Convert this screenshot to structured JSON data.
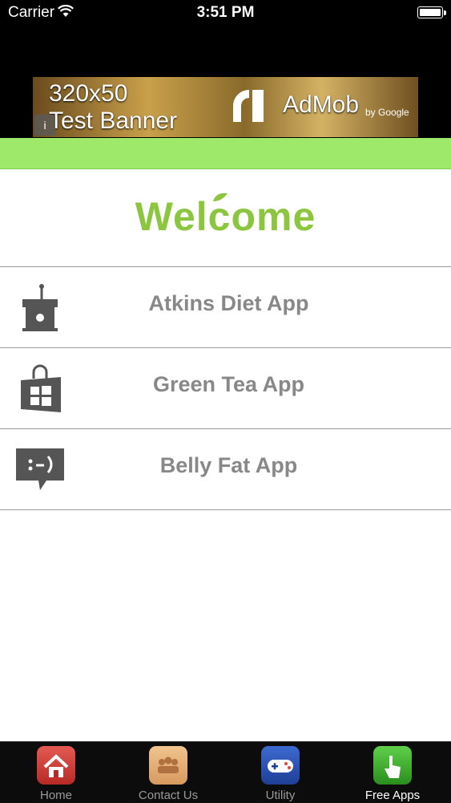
{
  "status_bar": {
    "carrier": "Carrier",
    "time": "3:51 PM"
  },
  "ad": {
    "size_text": "320x50",
    "test_text": "Test Banner",
    "info_glyph": "i",
    "brand": "AdMob",
    "byline": "by Google"
  },
  "welcome": {
    "title": "Welcome"
  },
  "menu": {
    "items": [
      {
        "label": "Atkins Diet App",
        "icon": "podium-microphone-icon"
      },
      {
        "label": "Green Tea App",
        "icon": "windows-store-bag-icon"
      },
      {
        "label": "Belly Fat App",
        "icon": "chat-bubble-emoticon-icon"
      }
    ]
  },
  "tabs": [
    {
      "label": "Home",
      "icon": "house-icon",
      "color": "#d23a34"
    },
    {
      "label": "Contact Us",
      "icon": "contacts-group-icon",
      "color": "#e2ad74"
    },
    {
      "label": "Utility",
      "icon": "gamepad-icon",
      "color": "#2c54b6"
    },
    {
      "label": "Free Apps",
      "icon": "hand-pointer-icon",
      "color": "#3fae2a"
    }
  ],
  "colors": {
    "accent_green": "#9ee86a",
    "welcome_green": "#8cc63f",
    "menu_text": "#888888",
    "tab_bar": "#0c0c0c"
  }
}
